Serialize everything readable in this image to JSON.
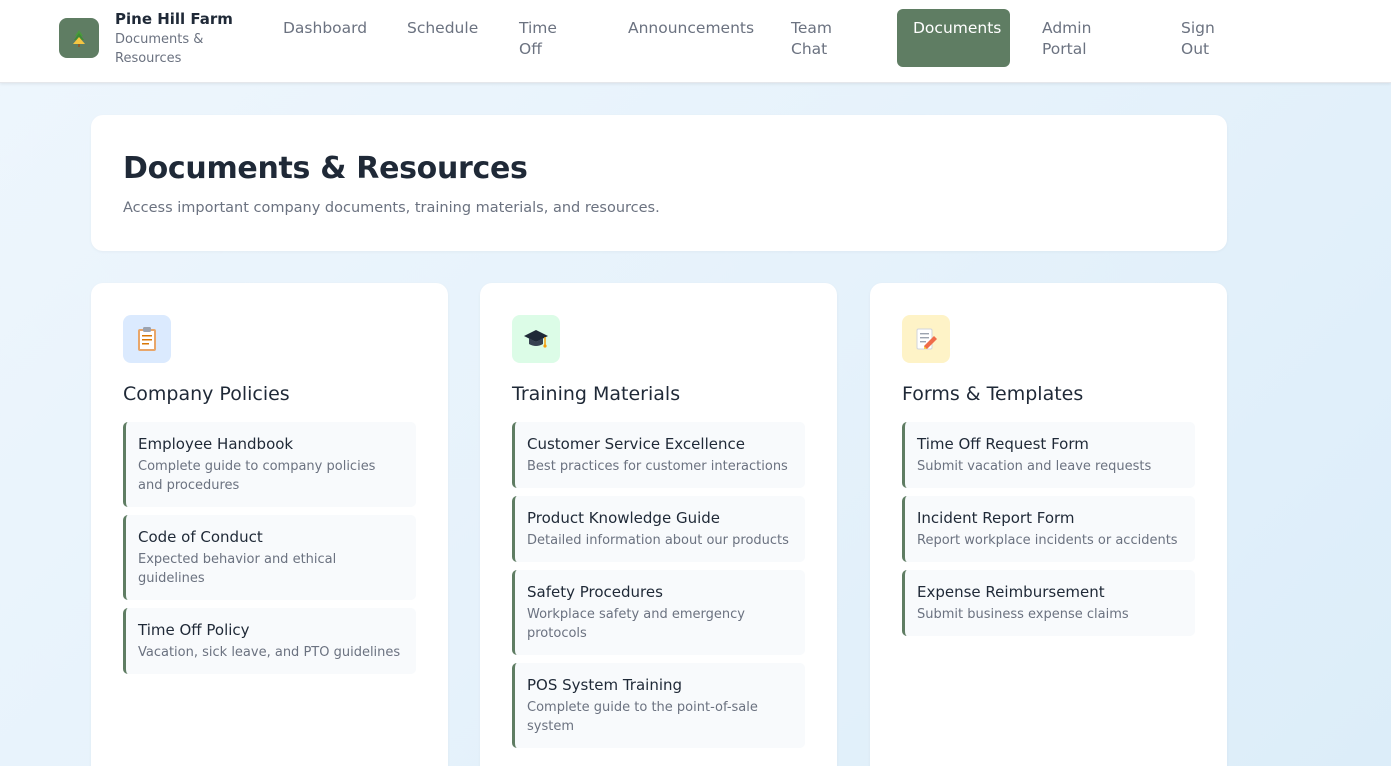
{
  "brand": {
    "name": "Pine Hill Farm",
    "subtitle": "Documents & Resources",
    "logo_icon": "tree-icon",
    "accent": "#5f7d63"
  },
  "nav": {
    "items": [
      {
        "label": "Dashboard"
      },
      {
        "label": "Schedule"
      },
      {
        "label": "Time Off"
      },
      {
        "label": "Announcements"
      },
      {
        "label": "Team Chat"
      },
      {
        "label": "Documents",
        "active": true
      },
      {
        "label": "Admin Portal"
      },
      {
        "label": "Sign Out"
      }
    ]
  },
  "hero": {
    "title": "Documents & Resources",
    "subtitle": "Access important company documents, training materials, and resources."
  },
  "categories": [
    {
      "title": "Company Policies",
      "icon": "clipboard-icon",
      "icon_bg": "#dbeafe",
      "items": [
        {
          "title": "Employee Handbook",
          "desc": "Complete guide to company policies and procedures"
        },
        {
          "title": "Code of Conduct",
          "desc": "Expected behavior and ethical guidelines"
        },
        {
          "title": "Time Off Policy",
          "desc": "Vacation, sick leave, and PTO guidelines"
        }
      ]
    },
    {
      "title": "Training Materials",
      "icon": "graduation-cap-icon",
      "icon_bg": "#dcfce7",
      "items": [
        {
          "title": "Customer Service Excellence",
          "desc": "Best practices for customer interactions"
        },
        {
          "title": "Product Knowledge Guide",
          "desc": "Detailed information about our products"
        },
        {
          "title": "Safety Procedures",
          "desc": "Workplace safety and emergency protocols"
        },
        {
          "title": "POS System Training",
          "desc": "Complete guide to the point-of-sale system"
        }
      ]
    },
    {
      "title": "Forms & Templates",
      "icon": "memo-icon",
      "icon_bg": "#fef3c7",
      "items": [
        {
          "title": "Time Off Request Form",
          "desc": "Submit vacation and leave requests"
        },
        {
          "title": "Incident Report Form",
          "desc": "Report workplace incidents or accidents"
        },
        {
          "title": "Expense Reimbursement",
          "desc": "Submit business expense claims"
        }
      ]
    }
  ]
}
